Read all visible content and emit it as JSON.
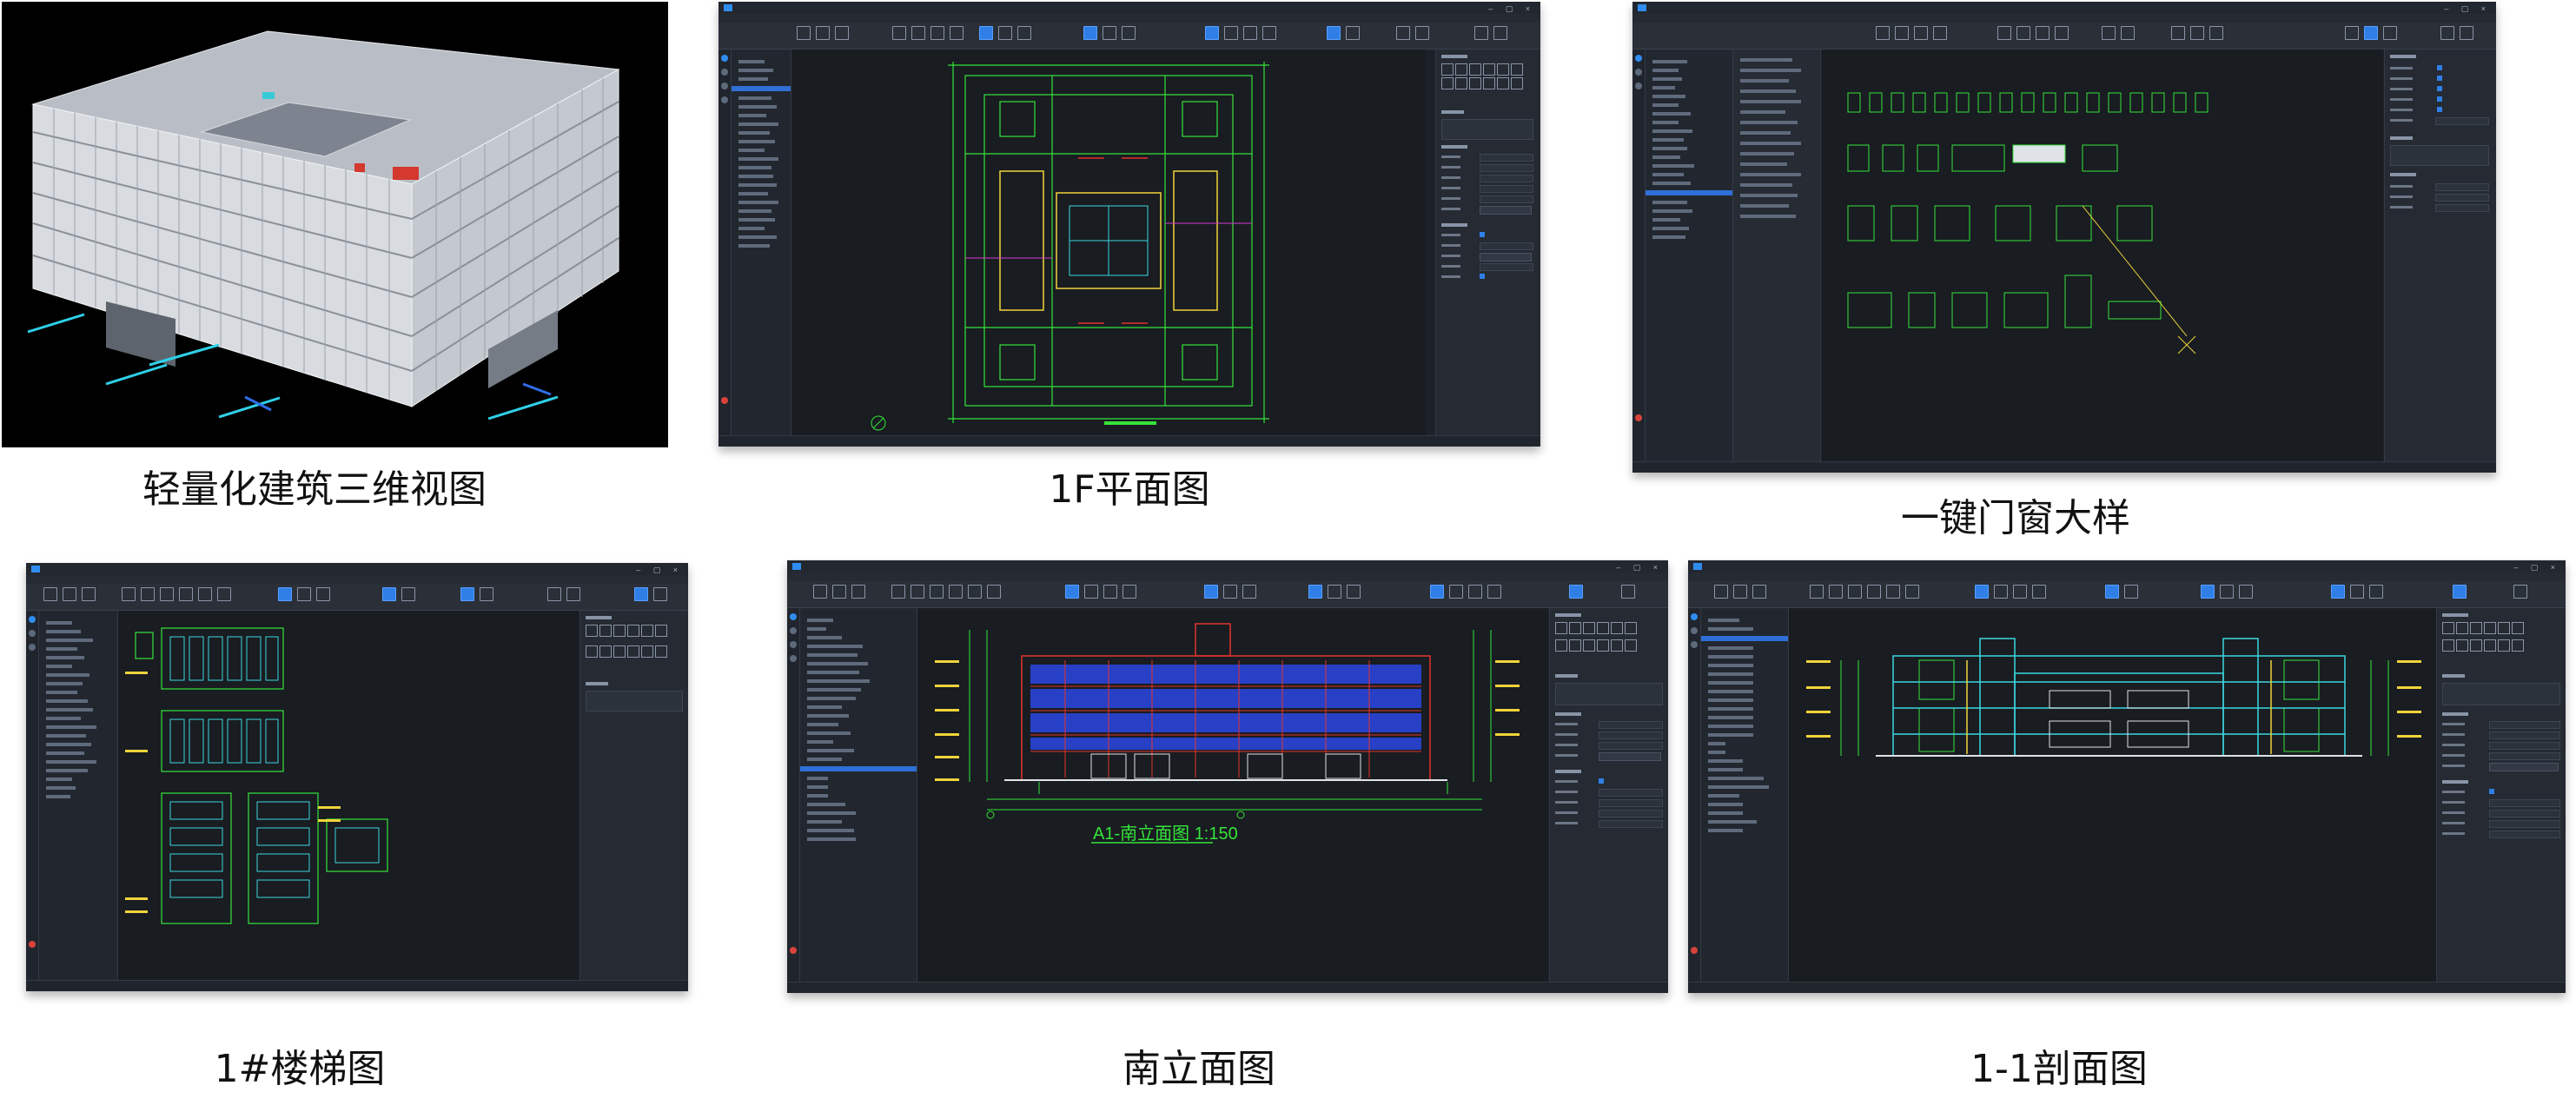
{
  "captions": {
    "view_3d": "轻量化建筑三维视图",
    "plan_1f": "1F平面图",
    "door_window": "一键门窗大样",
    "stair": "1#楼梯图",
    "south_elevation": "南立面图",
    "section": "1-1剖面图"
  },
  "elevation": {
    "title": "A1-南立面图  1:150"
  },
  "colors": {
    "app_background": "#1d2129",
    "canvas": "#191c21",
    "accent_blue": "#2f7fe6",
    "cad_green": "#35e43a",
    "cad_yellow": "#f0d43a",
    "cad_red": "#e2352d",
    "cad_cyan": "#3ad6e0",
    "cad_magenta": "#d83ad8"
  },
  "icons": {
    "app_logo": "app-logo-icon",
    "window_controls": "window-controls-icon"
  }
}
